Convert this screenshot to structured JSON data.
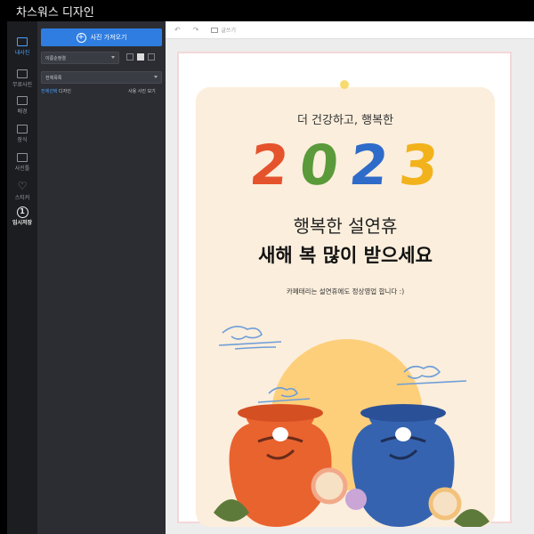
{
  "titlebar": {
    "title": "차스워스 디자인"
  },
  "rail": {
    "items": [
      {
        "label": "내사진",
        "active": true
      },
      {
        "label": "무료사진"
      },
      {
        "label": "배경"
      },
      {
        "label": "장식"
      },
      {
        "label": "사진틀"
      },
      {
        "label": "스티커"
      },
      {
        "label": "임시저장"
      }
    ]
  },
  "panel": {
    "import_label": "사진 가져오기",
    "sort_label": "이름순정렬",
    "folder_label": "전체목록",
    "select_all_prefix": "전체선택",
    "select_all_suffix": " 디자인",
    "used_link": "사용 사진 보기"
  },
  "toolbar": {
    "copy_label": "글쓰기"
  },
  "card": {
    "subtitle": "더 건강하고, 행복한",
    "year": "2023",
    "headline1": "행복한 설연휴",
    "headline2": "새해 복 많이 받으세요",
    "notice": "카페태리는 설연휴에도 정상영업 합니다 :)"
  },
  "colors": {
    "accent": "#2f7de1",
    "card_bg": "#fbeedc",
    "year_digits": [
      "#e5532c",
      "#5a9a3a",
      "#2f6bc8",
      "#f2b21b"
    ]
  }
}
